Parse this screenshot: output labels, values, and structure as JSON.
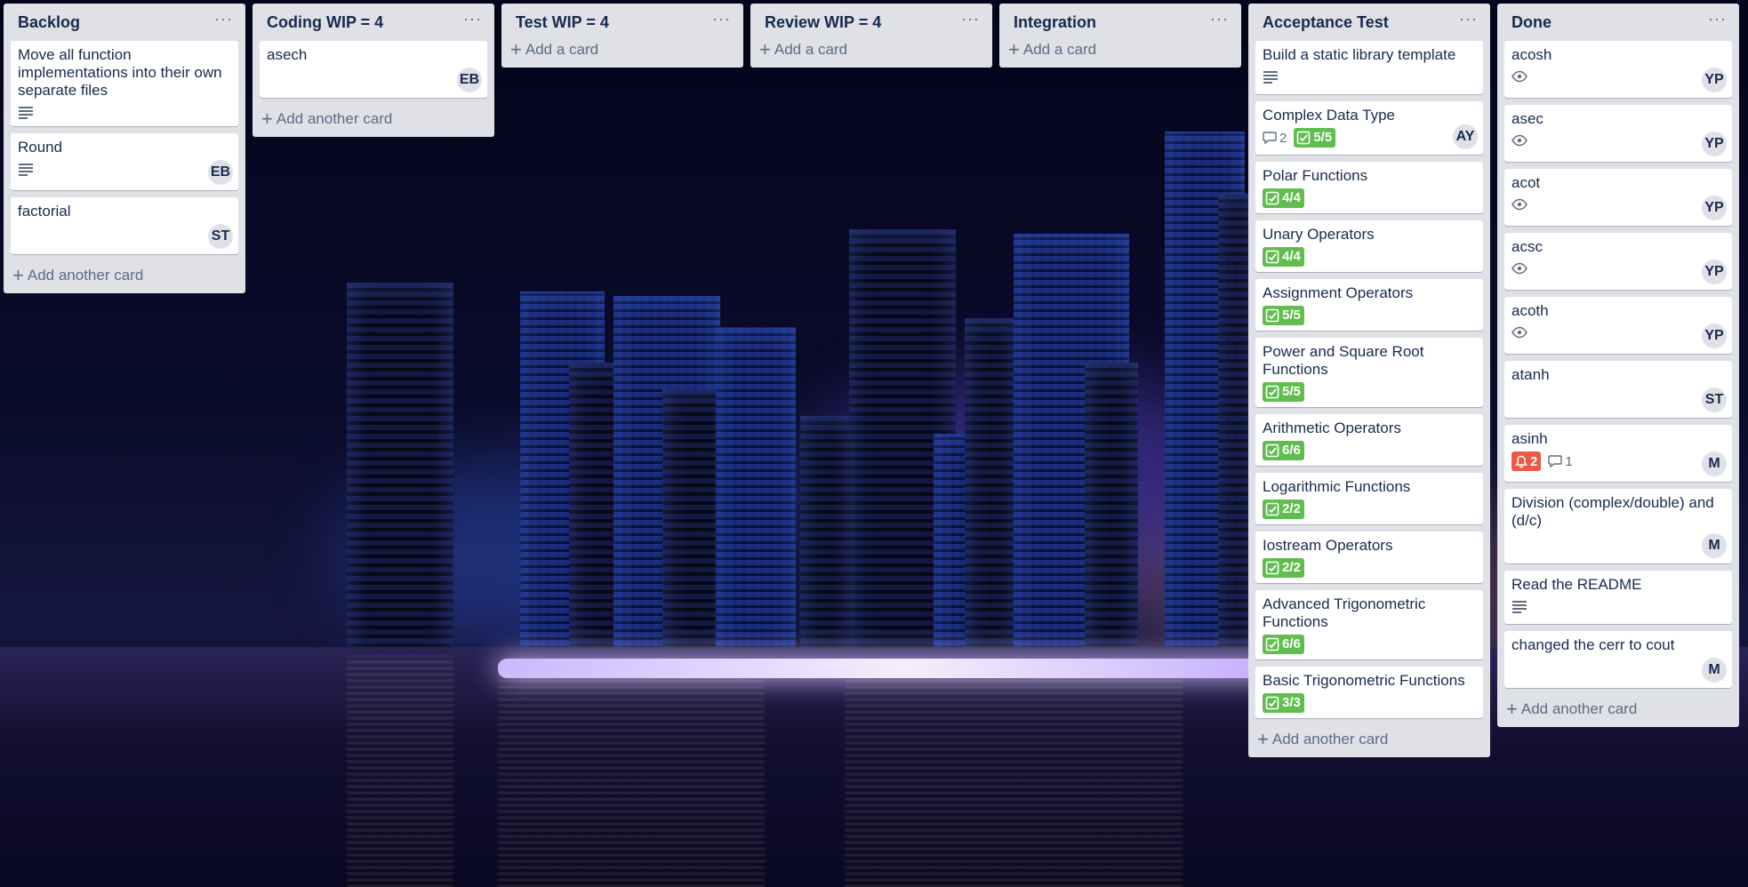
{
  "board": {
    "lists": [
      {
        "title": "Backlog",
        "menu": "···",
        "cards": [
          {
            "title": "Move all function implementations into their own separate files",
            "description": true
          },
          {
            "title": "Round",
            "description": true,
            "member": "EB"
          },
          {
            "title": "factorial",
            "member": "ST"
          }
        ],
        "add_label": "Add another card"
      },
      {
        "title": "Coding WIP = 4",
        "menu": "···",
        "cards": [
          {
            "title": "asech",
            "member": "EB"
          }
        ],
        "add_label": "Add another card"
      },
      {
        "title": "Test WIP = 4",
        "menu": "···",
        "cards": [],
        "add_label": "Add a card"
      },
      {
        "title": "Review WIP = 4",
        "menu": "···",
        "cards": [],
        "add_label": "Add a card"
      },
      {
        "title": "Integration",
        "menu": "···",
        "cards": [],
        "add_label": "Add a card"
      },
      {
        "title": "Acceptance Test",
        "menu": "···",
        "cards": [
          {
            "title": "Build a static library template",
            "description": true
          },
          {
            "title": "Complex Data Type",
            "comments": "2",
            "checklist": "5/5",
            "member": "AY"
          },
          {
            "title": "Polar Functions",
            "checklist": "4/4"
          },
          {
            "title": "Unary Operators",
            "checklist": "4/4"
          },
          {
            "title": "Assignment Operators",
            "checklist": "5/5"
          },
          {
            "title": "Power and Square Root Functions",
            "checklist": "5/5"
          },
          {
            "title": "Arithmetic Operators",
            "checklist": "6/6"
          },
          {
            "title": "Logarithmic Functions",
            "checklist": "2/2"
          },
          {
            "title": "Iostream Operators",
            "checklist": "2/2"
          },
          {
            "title": "Advanced Trigonometric Functions",
            "checklist": "6/6"
          },
          {
            "title": "Basic Trigonometric Functions",
            "checklist": "3/3"
          }
        ],
        "add_label": "Add another card"
      },
      {
        "title": "Done",
        "menu": "···",
        "cards": [
          {
            "title": "acosh",
            "watching": true,
            "member": "YP"
          },
          {
            "title": "asec",
            "watching": true,
            "member": "YP"
          },
          {
            "title": "acot",
            "watching": true,
            "member": "YP"
          },
          {
            "title": "acsc",
            "watching": true,
            "member": "YP"
          },
          {
            "title": "acoth",
            "watching": true,
            "member": "YP"
          },
          {
            "title": "atanh",
            "member": "ST"
          },
          {
            "title": "asinh",
            "notifications": "2",
            "comments": "1",
            "member": "M"
          },
          {
            "title": "Division (complex/double) and (d/c)",
            "member": "M"
          },
          {
            "title": "Read the README",
            "description": true
          },
          {
            "title": "changed the cerr to cout",
            "member": "M"
          }
        ],
        "add_label": "Add another card"
      }
    ]
  },
  "colors": {
    "list_bg": "#dfe1e6",
    "card_bg": "#ffffff",
    "checklist_complete": "#61bd4f",
    "notification": "#eb5a46",
    "text": "#172b4d",
    "muted": "#5e6c84"
  }
}
